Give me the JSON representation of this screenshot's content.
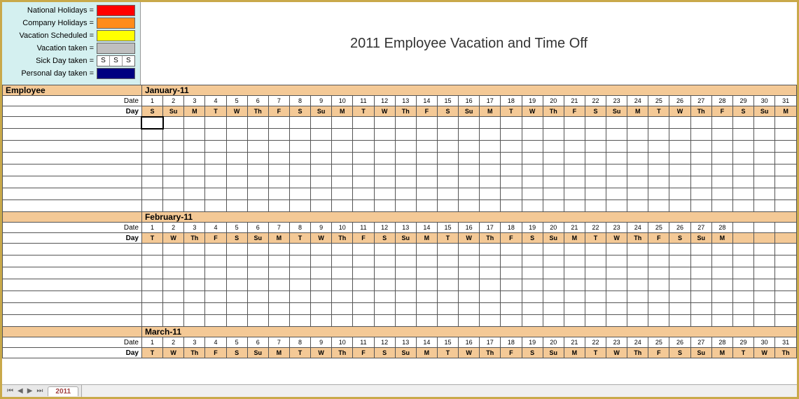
{
  "legend": {
    "national": {
      "label": "National Holidays =",
      "color": "#ff0000"
    },
    "company": {
      "label": "Company Holidays =",
      "color": "#ff8c1a"
    },
    "scheduled": {
      "label": "Vacation Scheduled =",
      "color": "#ffff00"
    },
    "taken": {
      "label": "Vacation taken =",
      "color": "#bfbfbf"
    },
    "sick": {
      "label": "Sick Day taken =",
      "s": "S"
    },
    "personal": {
      "label": "Personal day taken =",
      "color": "#000080"
    }
  },
  "title": "2011 Employee Vacation and Time Off",
  "employee_header": "Employee",
  "date_label": "Date",
  "day_label": "Day",
  "months": [
    {
      "name": "January-11",
      "days": 31,
      "dates": [
        "1",
        "2",
        "3",
        "4",
        "5",
        "6",
        "7",
        "8",
        "9",
        "10",
        "11",
        "12",
        "13",
        "14",
        "15",
        "16",
        "17",
        "18",
        "19",
        "20",
        "21",
        "22",
        "23",
        "24",
        "25",
        "26",
        "27",
        "28",
        "29",
        "30",
        "31"
      ],
      "dow": [
        "S",
        "Su",
        "M",
        "T",
        "W",
        "Th",
        "F",
        "S",
        "Su",
        "M",
        "T",
        "W",
        "Th",
        "F",
        "S",
        "Su",
        "M",
        "T",
        "W",
        "Th",
        "F",
        "S",
        "Su",
        "M",
        "T",
        "W",
        "Th",
        "F",
        "S",
        "Su",
        "M"
      ],
      "weekend": [
        1,
        1,
        0,
        0,
        0,
        0,
        0,
        1,
        1,
        0,
        0,
        0,
        0,
        0,
        1,
        1,
        0,
        0,
        0,
        0,
        0,
        1,
        1,
        0,
        0,
        0,
        0,
        0,
        1,
        1,
        0
      ],
      "empty_rows": 8
    },
    {
      "name": "February-11",
      "days": 28,
      "dates": [
        "1",
        "2",
        "3",
        "4",
        "5",
        "6",
        "7",
        "8",
        "9",
        "10",
        "11",
        "12",
        "13",
        "14",
        "15",
        "16",
        "17",
        "18",
        "19",
        "20",
        "21",
        "22",
        "23",
        "24",
        "25",
        "26",
        "27",
        "28"
      ],
      "dow": [
        "T",
        "W",
        "Th",
        "F",
        "S",
        "Su",
        "M",
        "T",
        "W",
        "Th",
        "F",
        "S",
        "Su",
        "M",
        "T",
        "W",
        "Th",
        "F",
        "S",
        "Su",
        "M",
        "T",
        "W",
        "Th",
        "F",
        "S",
        "Su",
        "M"
      ],
      "weekend": [
        0,
        0,
        0,
        0,
        1,
        1,
        0,
        0,
        0,
        0,
        0,
        1,
        1,
        0,
        0,
        0,
        0,
        0,
        1,
        1,
        0,
        0,
        0,
        0,
        0,
        1,
        1,
        0
      ],
      "empty_rows": 7
    },
    {
      "name": "March-11",
      "days": 31,
      "dates": [
        "1",
        "2",
        "3",
        "4",
        "5",
        "6",
        "7",
        "8",
        "9",
        "10",
        "11",
        "12",
        "13",
        "14",
        "15",
        "16",
        "17",
        "18",
        "19",
        "20",
        "21",
        "22",
        "23",
        "24",
        "25",
        "26",
        "27",
        "28",
        "29",
        "30",
        "31"
      ],
      "dow": [
        "T",
        "W",
        "Th",
        "F",
        "S",
        "Su",
        "M",
        "T",
        "W",
        "Th",
        "F",
        "S",
        "Su",
        "M",
        "T",
        "W",
        "Th",
        "F",
        "S",
        "Su",
        "M",
        "T",
        "W",
        "Th",
        "F",
        "S",
        "Su",
        "M",
        "T",
        "W",
        "Th"
      ],
      "weekend": [
        0,
        0,
        0,
        0,
        1,
        1,
        0,
        0,
        0,
        0,
        0,
        1,
        1,
        0,
        0,
        0,
        0,
        0,
        1,
        1,
        0,
        0,
        0,
        0,
        0,
        1,
        1,
        0,
        0,
        0,
        0
      ],
      "empty_rows": 0
    }
  ],
  "sheet_tab": "2011",
  "max_cols": 31
}
